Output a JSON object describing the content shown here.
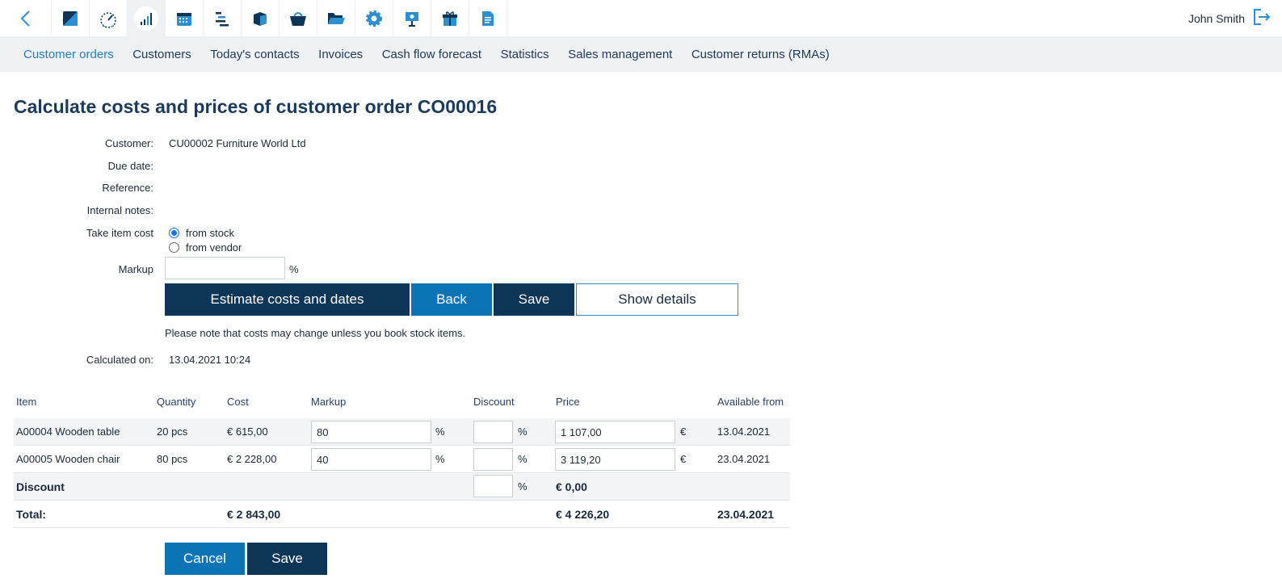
{
  "user": {
    "name": "John Smith"
  },
  "nav": {
    "tabs": [
      {
        "label": "Customer orders",
        "active": true
      },
      {
        "label": "Customers"
      },
      {
        "label": "Today's contacts"
      },
      {
        "label": "Invoices"
      },
      {
        "label": "Cash flow forecast"
      },
      {
        "label": "Statistics"
      },
      {
        "label": "Sales management"
      },
      {
        "label": "Customer returns (RMAs)"
      }
    ]
  },
  "page": {
    "title": "Calculate costs and prices of customer order CO00016"
  },
  "form": {
    "customer_label": "Customer:",
    "customer_value": "CU00002 Furniture World Ltd",
    "due_date_label": "Due date:",
    "reference_label": "Reference:",
    "internal_notes_label": "Internal notes:",
    "take_item_cost_label": "Take item cost",
    "option_stock": "from stock",
    "option_vendor": "from vendor",
    "markup_label": "Markup",
    "markup_value": "",
    "percent": "%",
    "calculated_on_label": "Calculated on:",
    "calculated_on_value": "13.04.2021 10:24"
  },
  "buttons": {
    "estimate": "Estimate costs and dates",
    "back": "Back",
    "save": "Save",
    "show_details": "Show details",
    "cancel": "Cancel",
    "save_bottom": "Save"
  },
  "note": "Please note that costs may change unless you book stock items.",
  "table": {
    "headers": [
      "Item",
      "Quantity",
      "Cost",
      "Markup",
      "Discount",
      "Price",
      "Available from"
    ],
    "rows": [
      {
        "item": "A00004 Wooden table",
        "quantity": "20 pcs",
        "cost": "€ 615,00",
        "markup": "80",
        "discount": "",
        "price": "1 107,00",
        "currency": "€",
        "available": "13.04.2021"
      },
      {
        "item": "A00005 Wooden chair",
        "quantity": "80 pcs",
        "cost": "€ 2 228,00",
        "markup": "40",
        "discount": "",
        "price": "3 119,20",
        "currency": "€",
        "available": "23.04.2021"
      }
    ],
    "discount_row": {
      "label": "Discount",
      "discount": "",
      "price": "€ 0,00"
    },
    "total_row": {
      "label": "Total:",
      "cost": "€ 2 843,00",
      "price": "€ 4 226,20",
      "available": "23.04.2021"
    }
  },
  "icons": [
    "back-icon",
    "notes-icon",
    "dashboard-icon",
    "statistics-icon",
    "calendar-icon",
    "planning-icon",
    "product-icon",
    "basket-icon",
    "folder-icon",
    "settings-icon",
    "presentation-icon",
    "gift-icon",
    "document-icon",
    "logout-icon"
  ],
  "colors": {
    "dark": "#0d3557",
    "blue": "#0a74b5",
    "active_tab": "#2b7bb5"
  }
}
